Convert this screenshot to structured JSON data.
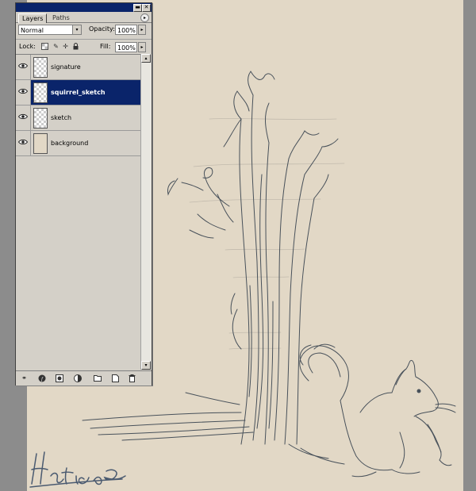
{
  "palette": {
    "tabs": [
      {
        "label": "Layers",
        "active": true
      },
      {
        "label": "Paths",
        "active": false
      }
    ],
    "window_buttons": {
      "minimize": "▬",
      "close": "✕"
    },
    "menu_button": "▸",
    "blend_mode": {
      "value": "Normal",
      "arrow": "▾"
    },
    "opacity": {
      "label": "Opacity:",
      "value": "100%",
      "arrow": "▸"
    },
    "lock": {
      "label": "Lock:",
      "icons": [
        "lock-transparent-icon",
        "lock-image-icon",
        "lock-position-icon",
        "lock-all-icon"
      ]
    },
    "fill": {
      "label": "Fill:",
      "value": "100%",
      "arrow": "▸"
    },
    "layers": [
      {
        "name": "signature",
        "visible": true,
        "selected": false,
        "thumbnail": "transparent"
      },
      {
        "name": "squirrel_sketch",
        "visible": true,
        "selected": true,
        "thumbnail": "transparent"
      },
      {
        "name": "sketch",
        "visible": true,
        "selected": false,
        "thumbnail": "transparent"
      },
      {
        "name": "background",
        "visible": true,
        "selected": false,
        "thumbnail": "solid"
      }
    ],
    "scroll": {
      "up": "▴",
      "down": "▾"
    },
    "footer_icons": [
      "link-layers-icon",
      "layer-style-icon",
      "layer-mask-icon",
      "adjustment-layer-icon",
      "new-group-icon",
      "new-layer-icon",
      "trash-icon"
    ]
  },
  "document": {
    "background_color": "#e2d8c6",
    "signature_text": "Hatice S."
  },
  "colors": {
    "titlebar": "#0a246a",
    "panel": "#d4d0c8",
    "selection": "#0a246a",
    "ink": "#2e3a48"
  }
}
